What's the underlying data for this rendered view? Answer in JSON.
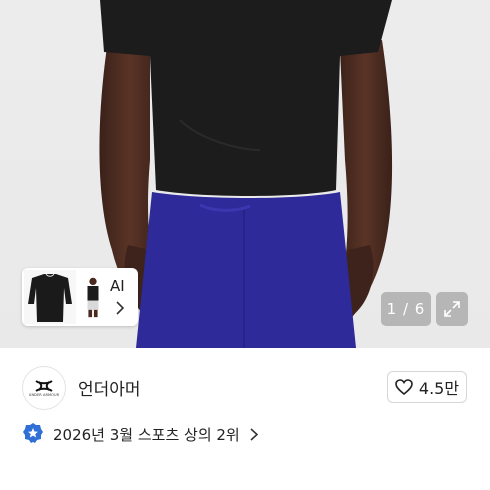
{
  "product_image": {
    "counter": "1 / 6",
    "ai_label": "AI"
  },
  "brand": {
    "logo_caption": "UNDER ARMOUR",
    "name": "언더아머"
  },
  "like": {
    "count": "4.5만"
  },
  "ranking": {
    "text": "2026년 3월 스포츠 상의 2위"
  },
  "colors": {
    "shirt": "#1c1c1c",
    "shorts": "#2e2a9a",
    "skin": "#4a2a1f",
    "background": "#ececec"
  },
  "icons": [
    "expand-icon",
    "chevron-right-icon",
    "heart-icon",
    "badge-icon",
    "under-armour-logo-icon"
  ]
}
